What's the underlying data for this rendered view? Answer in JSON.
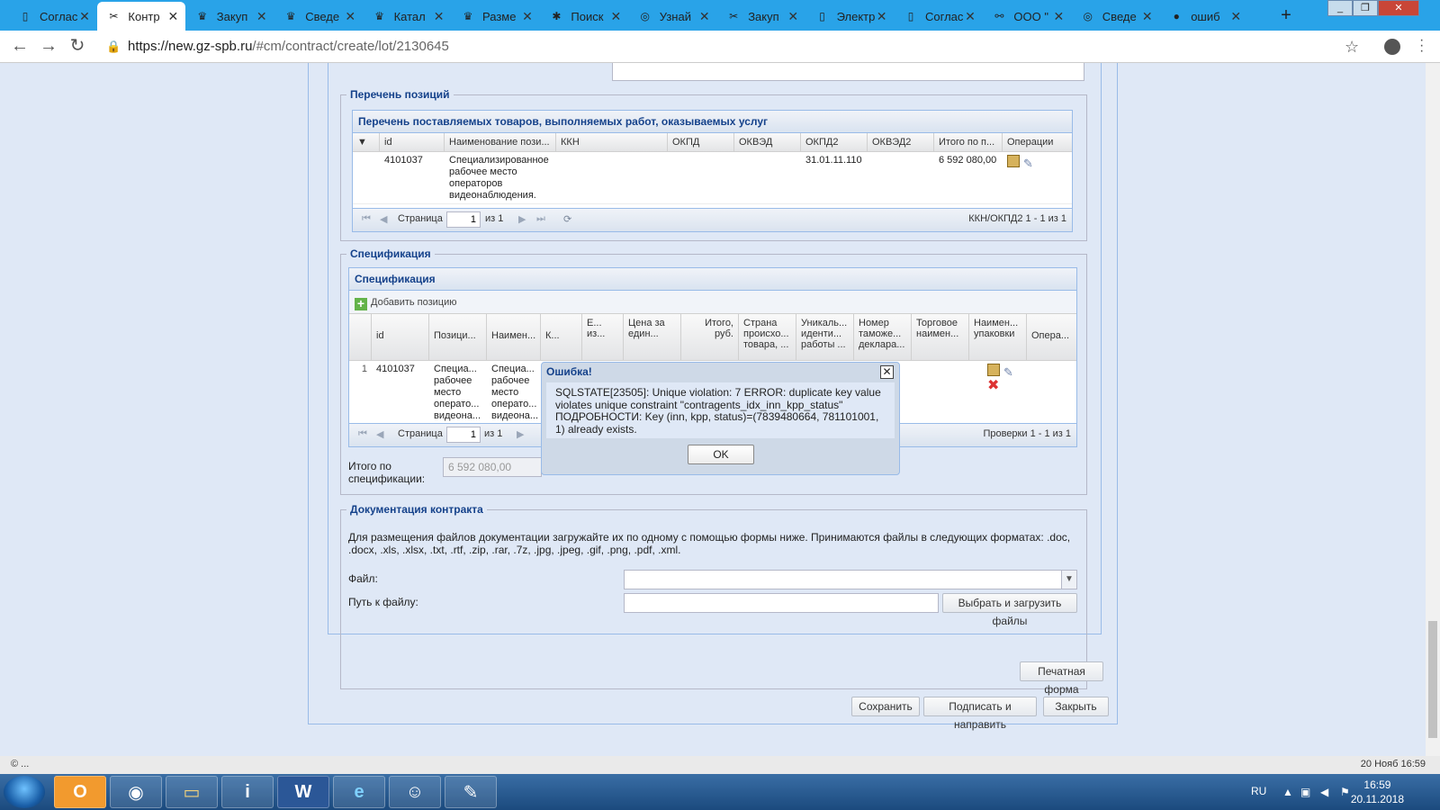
{
  "browser": {
    "tabs": [
      {
        "label": "Соглас",
        "icon": "document-icon",
        "active": false
      },
      {
        "label": "Контр",
        "icon": "tools-icon",
        "active": true
      },
      {
        "label": "Закуп",
        "icon": "emblem-icon",
        "active": false
      },
      {
        "label": "Сведе",
        "icon": "emblem-icon",
        "active": false
      },
      {
        "label": "Катал",
        "icon": "emblem-icon",
        "active": false
      },
      {
        "label": "Разме",
        "icon": "emblem-icon",
        "active": false
      },
      {
        "label": "Поиск",
        "icon": "snowflake-icon",
        "active": false
      },
      {
        "label": "Узнай",
        "icon": "shield-icon",
        "active": false
      },
      {
        "label": "Закуп",
        "icon": "tools-icon",
        "active": false
      },
      {
        "label": "Электр",
        "icon": "document-icon",
        "active": false
      },
      {
        "label": "Соглас",
        "icon": "document-icon",
        "active": false
      },
      {
        "label": "ООО \"",
        "icon": "nodes-icon",
        "active": false
      },
      {
        "label": "Сведе",
        "icon": "shield-icon",
        "active": false
      },
      {
        "label": "ошиб",
        "icon": "globe-icon",
        "active": false
      }
    ],
    "url_host": "https://new.gz-spb.ru",
    "url_path": "/#cm/contract/create/lot/2130645"
  },
  "positions": {
    "legend": "Перечень позиций",
    "grid_title": "Перечень поставляемых товаров, выполняемых работ, оказываемых услуг",
    "columns": [
      "id",
      "Наименование пози...",
      "ККН",
      "ОКПД",
      "ОКВЭД",
      "ОКПД2",
      "ОКВЭД2",
      "Итого по п...",
      "Операции"
    ],
    "rows": [
      {
        "id": "4101037",
        "name": "Специализированное рабочее место операторов видеонаблюдения.",
        "kkn": "",
        "okpd": "",
        "okved": "",
        "okpd2": "31.01.11.110",
        "okved2": "",
        "total": "6 592 080,00"
      }
    ],
    "pager_label": "Страница",
    "pager_page": "1",
    "pager_of": "из 1",
    "pager_summary": "ККН/ОКПД2 1 - 1 из 1"
  },
  "spec": {
    "legend": "Спецификация",
    "grid_title": "Спецификация",
    "add_label": "Добавить позицию",
    "columns": [
      "id",
      "Позици...",
      "Наимен...",
      "К...",
      "Е... из...",
      "Цена за един...",
      "Итого, руб.",
      "Страна происхо... товара, ...",
      "Уникаль... иденти... работы ...",
      "Номер таможе... деклара...",
      "Торговое наимен...",
      "Наимен... упаковки",
      "Опера..."
    ],
    "row": {
      "num": "1",
      "id": "4101037",
      "pos": "Специа... рабочее место операто... видеона...",
      "name": "Специа... рабочее место операто... видеона..."
    },
    "pager_label": "Страница",
    "pager_page": "1",
    "pager_of": "из 1",
    "pager_summary": "Проверки 1 - 1 из 1",
    "total_label": "Итого по спецификации:",
    "total_value": "6 592 080,00"
  },
  "docs": {
    "legend": "Документация контракта",
    "info": "Для размещения файлов документации загружайте их по одному с помощью формы ниже. Принимаются файлы в следующих форматах: .doc, .docx, .xls, .xlsx, .txt, .rtf, .zip, .rar, .7z, .jpg, .jpeg, .gif, .png, .pdf, .xml.",
    "file_label": "Файл:",
    "path_label": "Путь к файлу:",
    "upload_button": "Выбрать и загрузить файлы"
  },
  "actions": {
    "print": "Печатная форма",
    "save": "Сохранить",
    "sign": "Подписать и направить",
    "close": "Закрыть"
  },
  "modal": {
    "title": "Ошибка!",
    "message": "SQLSTATE[23505]: Unique violation: 7 ERROR: duplicate key value violates unique constraint \"contragents_idx_inn_kpp_status\" ПОДРОБНОСТИ: Key (inn, kpp, status)=(7839480664, 781101001, 1) already exists.",
    "ok": "OK"
  },
  "status": {
    "left": "© ...",
    "right": "20 Нояб 16:59"
  },
  "taskbar": {
    "lang": "RU",
    "time": "16:59",
    "date": "20.11.2018"
  }
}
